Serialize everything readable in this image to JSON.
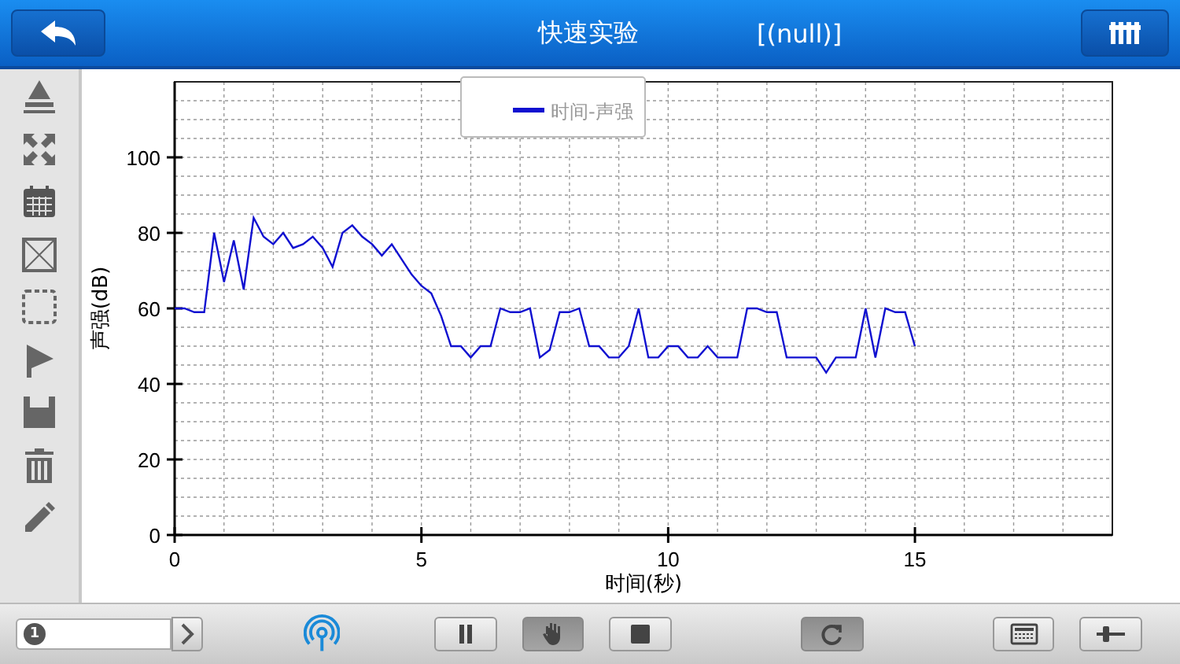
{
  "header": {
    "title": "快速实验",
    "subtitle": "[(null)]"
  },
  "chart": {
    "chart_data": {
      "type": "line",
      "grid": true,
      "xlabel": "时间(秒)",
      "ylabel": "声强(dB)",
      "xlim": [
        0,
        19
      ],
      "ylim": [
        0,
        120
      ],
      "xticks": [
        0,
        5,
        10,
        15
      ],
      "yticks": [
        0,
        20,
        40,
        60,
        80,
        100
      ],
      "x": [
        0,
        0.2,
        0.4,
        0.6,
        0.8,
        1,
        1.2,
        1.4,
        1.6,
        1.8,
        2,
        2.2,
        2.4,
        2.6,
        2.8,
        3,
        3.2,
        3.4,
        3.6,
        3.8,
        4,
        4.2,
        4.4,
        4.6,
        4.8,
        5,
        5.2,
        5.4,
        5.6,
        5.8,
        6,
        6.2,
        6.4,
        6.6,
        6.8,
        7,
        7.2,
        7.4,
        7.6,
        7.8,
        8,
        8.2,
        8.4,
        8.6,
        8.8,
        9,
        9.2,
        9.4,
        9.6,
        9.8,
        10,
        10.2,
        10.4,
        10.6,
        10.8,
        11,
        11.2,
        11.4,
        11.6,
        11.8,
        12,
        12.2,
        12.4,
        12.6,
        12.8,
        13,
        13.2,
        13.4,
        13.6,
        13.8,
        14,
        14.2,
        14.4,
        14.6,
        14.8,
        15
      ],
      "series": [
        {
          "name": "时间-声强",
          "color": "#1010d0",
          "values": [
            60,
            60,
            59,
            59,
            80,
            67,
            78,
            65,
            84,
            79,
            77,
            80,
            76,
            77,
            79,
            76,
            71,
            80,
            82,
            79,
            77,
            74,
            77,
            73,
            69,
            66,
            64,
            58,
            50,
            50,
            47,
            50,
            50,
            60,
            59,
            59,
            60,
            47,
            49,
            59,
            59,
            60,
            50,
            50,
            47,
            47,
            50,
            60,
            47,
            47,
            50,
            50,
            47,
            47,
            50,
            47,
            47,
            47,
            60,
            60,
            59,
            59,
            47,
            47,
            47,
            47,
            43,
            47,
            47,
            47,
            60,
            47,
            60,
            59,
            59,
            50
          ]
        }
      ]
    }
  },
  "bottom_bar": {
    "page": "1",
    "buttons": [
      {
        "kind": "pause",
        "pressed": false
      },
      {
        "kind": "hand",
        "pressed": true
      },
      {
        "kind": "stop",
        "pressed": false
      },
      {
        "kind": "refresh",
        "pressed": true
      },
      {
        "kind": "keypad",
        "pressed": false
      },
      {
        "kind": "slider",
        "pressed": false
      }
    ]
  }
}
